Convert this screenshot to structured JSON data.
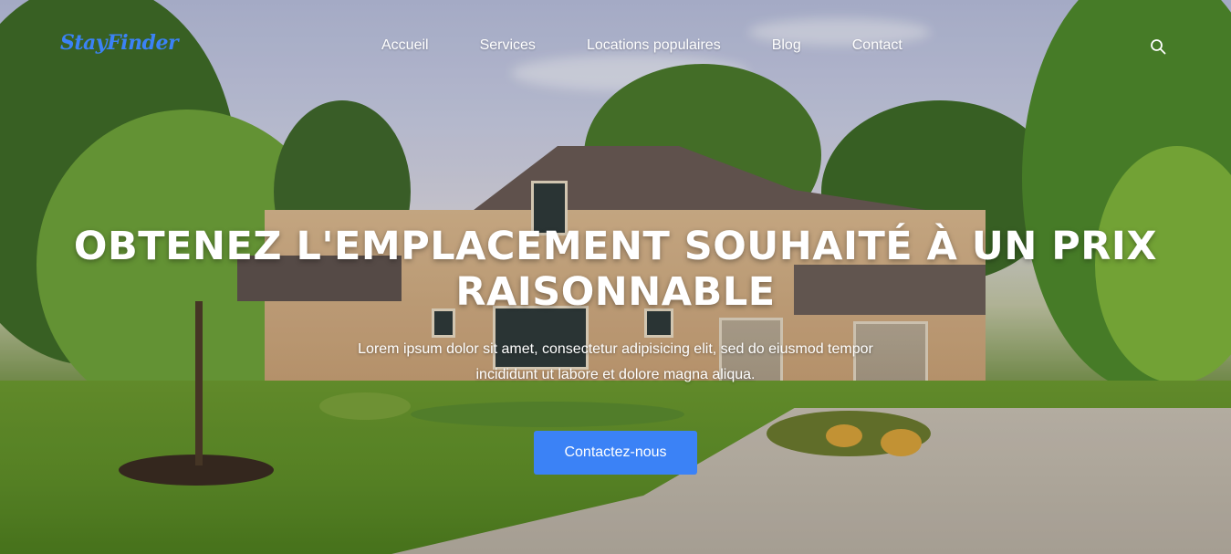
{
  "brand": {
    "logo_text": "StayFinder",
    "accent_color": "#3b82f6"
  },
  "nav": {
    "items": [
      {
        "label": "Accueil"
      },
      {
        "label": "Services"
      },
      {
        "label": "Locations populaires"
      },
      {
        "label": "Blog"
      },
      {
        "label": "Contact"
      }
    ],
    "search_icon": "search-icon"
  },
  "hero": {
    "title_line1": "OBTENEZ L'EMPLACEMENT SOUHAITÉ À UN PRIX",
    "title_line2": "RAISONNABLE",
    "subtitle_line1": "Lorem ipsum dolor sit amet, consectetur adipisicing elit, sed do eiusmod tempor",
    "subtitle_line2": "incididunt ut labore et dolore magna aliqua.",
    "cta_label": "Contactez-nous"
  }
}
